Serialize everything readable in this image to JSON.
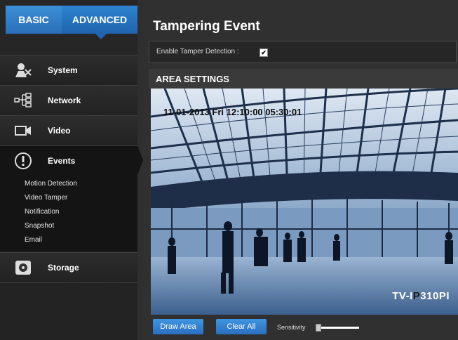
{
  "tabs": {
    "basic": "BASIC",
    "advanced": "ADVANCED"
  },
  "sidebar": {
    "items": [
      {
        "label": "System",
        "icon": "system-icon"
      },
      {
        "label": "Network",
        "icon": "network-icon"
      },
      {
        "label": "Video",
        "icon": "video-icon"
      },
      {
        "label": "Events",
        "icon": "events-icon"
      },
      {
        "label": "Storage",
        "icon": "storage-icon"
      }
    ],
    "events_submenu": [
      "Motion Detection",
      "Video Tamper",
      "Notification",
      "Snapshot",
      "Email"
    ]
  },
  "main": {
    "title": "Tampering Event",
    "enable_label": "Enable Tamper Detection :",
    "enable_checked": true,
    "area_title": "AREA SETTINGS",
    "timestamp": "11-01-2013 Fri 12:10:00 05:30:01",
    "camera_name_1": "TV-I",
    "camera_name_2": "P",
    "camera_name_3": "310PI",
    "buttons": {
      "draw": "Draw Area",
      "clear": "Clear All"
    },
    "sensitivity_label": "Sensitivity",
    "sensitivity_value": 0
  },
  "colors": {
    "accent": "#2a6fc0",
    "sidebar": "#262626",
    "active": "#141414"
  }
}
